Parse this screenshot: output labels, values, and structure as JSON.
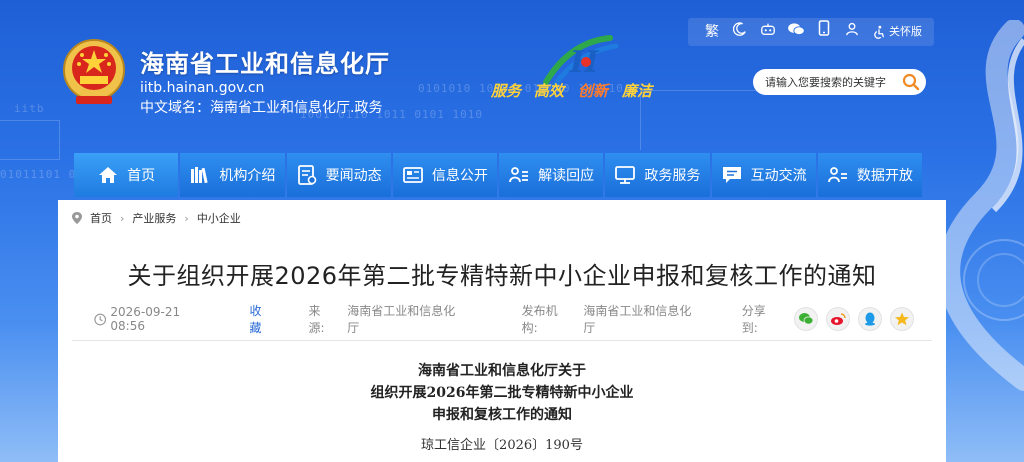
{
  "header": {
    "site_title": "海南省工业和信息化厅",
    "domain": "iitb.hainan.gov.cn",
    "cn_domain": "中文域名：海南省工业和信息化厅.政务",
    "slogan": [
      "服务",
      "高效",
      "创新",
      "廉洁"
    ],
    "utility": {
      "traditional": "繁",
      "care_mode": "关怀版",
      "icons": [
        "moon-icon",
        "robot-icon",
        "wechat-icon",
        "mobile-icon",
        "user-icon",
        "accessibility-icon"
      ]
    },
    "search": {
      "placeholder": "请输入您要搜索的关键字"
    }
  },
  "nav": {
    "items": [
      {
        "label": "首页",
        "icon": "home-icon"
      },
      {
        "label": "机构介绍",
        "icon": "books-icon"
      },
      {
        "label": "要闻动态",
        "icon": "document-icon"
      },
      {
        "label": "信息公开",
        "icon": "newspaper-icon"
      },
      {
        "label": "解读回应",
        "icon": "person-list-icon"
      },
      {
        "label": "政务服务",
        "icon": "monitor-icon"
      },
      {
        "label": "互动交流",
        "icon": "chat-icon"
      },
      {
        "label": "数据开放",
        "icon": "person-data-icon"
      }
    ]
  },
  "breadcrumb": [
    "首页",
    "产业服务",
    "中小企业"
  ],
  "article": {
    "title": "关于组织开展2026年第二批专精特新中小企业申报和复核工作的通知",
    "date": "2026-09-21 08:56",
    "favorite": "收藏",
    "source_label": "来源:",
    "source": "海南省工业和信息化厅",
    "publisher_label": "发布机构:",
    "publisher": "海南省工业和信息化厅",
    "share_label": "分享到:",
    "share_targets": [
      "wechat-share-icon",
      "weibo-share-icon",
      "qq-share-icon",
      "qzone-share-icon"
    ],
    "doc_heading": [
      "海南省工业和信息化厅关于",
      "组织开展2026年第二批专精特新中小企业",
      "申报和复核工作的通知"
    ],
    "doc_number": "琼工信企业〔2026〕190号"
  },
  "colors": {
    "nav_bg": "#1a6fd9",
    "accent_link": "#2b6bd6",
    "slogan_yellow": "#ffd23a",
    "slogan_orange": "#ff7b2b"
  }
}
